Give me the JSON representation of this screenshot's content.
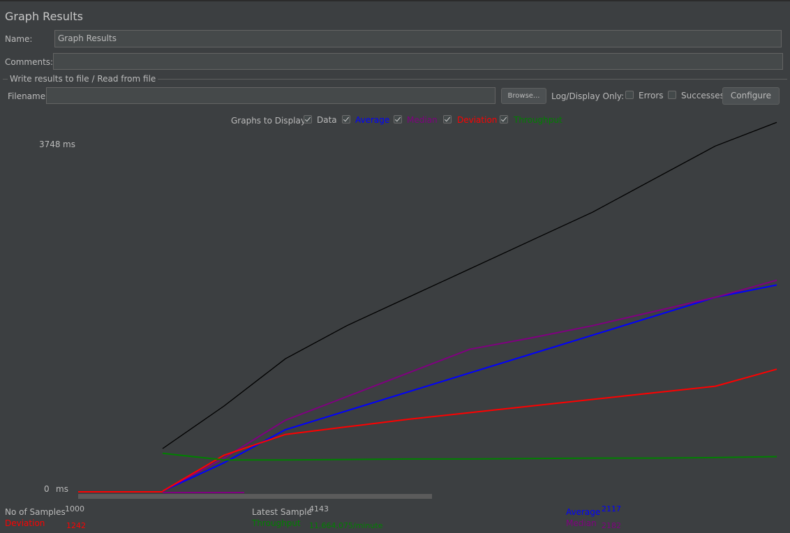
{
  "panel": {
    "title": "Graph Results",
    "name_label": "Name:",
    "name_value": "Graph Results",
    "comments_label": "Comments:",
    "comments_value": ""
  },
  "file_group": {
    "title": "Write results to file / Read from file",
    "filename_label": "Filename",
    "filename_value": "",
    "browse_label": "Browse...",
    "log_display_label": "Log/Display Only:",
    "errors_label": "Errors",
    "errors_checked": false,
    "successes_label": "Successes",
    "successes_checked": false,
    "configure_label": "Configure"
  },
  "graphs_to_display": {
    "label": "Graphs to Display",
    "options": [
      {
        "label": "Data",
        "color": "#bbbbbb",
        "checked": true
      },
      {
        "label": "Average",
        "color": "#0000ff",
        "checked": true
      },
      {
        "label": "Median",
        "color": "#800080",
        "checked": true
      },
      {
        "label": "Deviation",
        "color": "#ff0000",
        "checked": true
      },
      {
        "label": "Throughput",
        "color": "#008000",
        "checked": true
      }
    ]
  },
  "graph": {
    "y_max_label": "3748",
    "y_min_label": "0",
    "y_unit": "ms"
  },
  "stats": {
    "samples_label": "No of Samples",
    "samples_value": "1000",
    "deviation_label": "Deviation",
    "deviation_value": "1242",
    "latest_label": "Latest Sample",
    "latest_value": "4143",
    "throughput_label": "Throughput",
    "throughput_value": "11,664,075/minute",
    "average_label": "Average",
    "average_value": "2117",
    "median_label": "Median",
    "median_value": "2182"
  },
  "colors": {
    "data": "#000000",
    "average": "#0000ff",
    "median": "#800080",
    "deviation": "#ff0000",
    "throughput": "#008000"
  },
  "chart_data": {
    "type": "line",
    "ylim": [
      0,
      3748
    ],
    "x": [
      0,
      100,
      200,
      300,
      400,
      500,
      600,
      700,
      800,
      900,
      1000
    ],
    "series": [
      {
        "name": "Data",
        "values": [
          450,
          900,
          1400,
          1750,
          2050,
          2350,
          2650,
          2950,
          3300,
          3650,
          3900
        ]
      },
      {
        "name": "Average",
        "values": [
          0,
          300,
          650,
          850,
          1050,
          1250,
          1450,
          1650,
          1850,
          2050,
          2180
        ]
      },
      {
        "name": "Median",
        "values": [
          0,
          350,
          750,
          1000,
          1250,
          1500,
          1620,
          1750,
          1900,
          2050,
          2230
        ]
      },
      {
        "name": "Deviation",
        "values": [
          0,
          380,
          600,
          680,
          760,
          830,
          900,
          970,
          1040,
          1110,
          1290
        ]
      },
      {
        "name": "Throughput",
        "values": [
          400,
          330,
          330,
          335,
          340,
          340,
          345,
          350,
          350,
          355,
          365
        ]
      }
    ]
  }
}
